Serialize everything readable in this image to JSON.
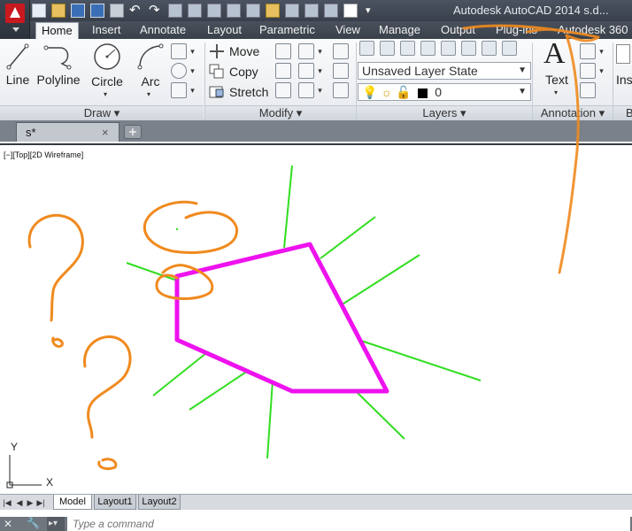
{
  "app": {
    "title": "Autodesk AutoCAD 2014   s.d..."
  },
  "quick_access": {
    "icons": [
      "new-icon",
      "open-icon",
      "save-icon",
      "save-as-icon",
      "plot-icon",
      "undo-icon",
      "redo-icon",
      "match-icon",
      "block-icon",
      "window-icon",
      "hatch-icon",
      "layer-icon",
      "folder-icon",
      "publish-icon",
      "tool-icon",
      "brush-icon",
      "color-icon",
      "more-icon"
    ]
  },
  "ribbon_tabs": [
    "Home",
    "Insert",
    "Annotate",
    "Layout",
    "Parametric",
    "View",
    "Manage",
    "Output",
    "Plug-ins",
    "Autodesk 360"
  ],
  "panels": {
    "draw": {
      "title": "Draw",
      "line": "Line",
      "polyline": "Polyline",
      "circle": "Circle",
      "arc": "Arc"
    },
    "modify": {
      "title": "Modify",
      "move": "Move",
      "copy": "Copy",
      "stretch": "Stretch"
    },
    "layers": {
      "title": "Layers",
      "layer_state": "Unsaved Layer State",
      "current_layer": "0"
    },
    "annotation": {
      "title": "Annotation",
      "text": "Text"
    },
    "insert": {
      "label": "Ins",
      "title": "B"
    }
  },
  "file_tabs": {
    "current": "s*",
    "close": "×"
  },
  "viewport": {
    "label": "[−][Top][2D Wireframe]",
    "ucs_y": "Y",
    "ucs_x": "X"
  },
  "layout_tabs": [
    "Model",
    "Layout1",
    "Layout2"
  ],
  "command_line": {
    "placeholder": "Type a command"
  },
  "colors": {
    "polygon": "#ee12ee",
    "lines": "#33dd22",
    "annotation": "#f08a1e"
  }
}
